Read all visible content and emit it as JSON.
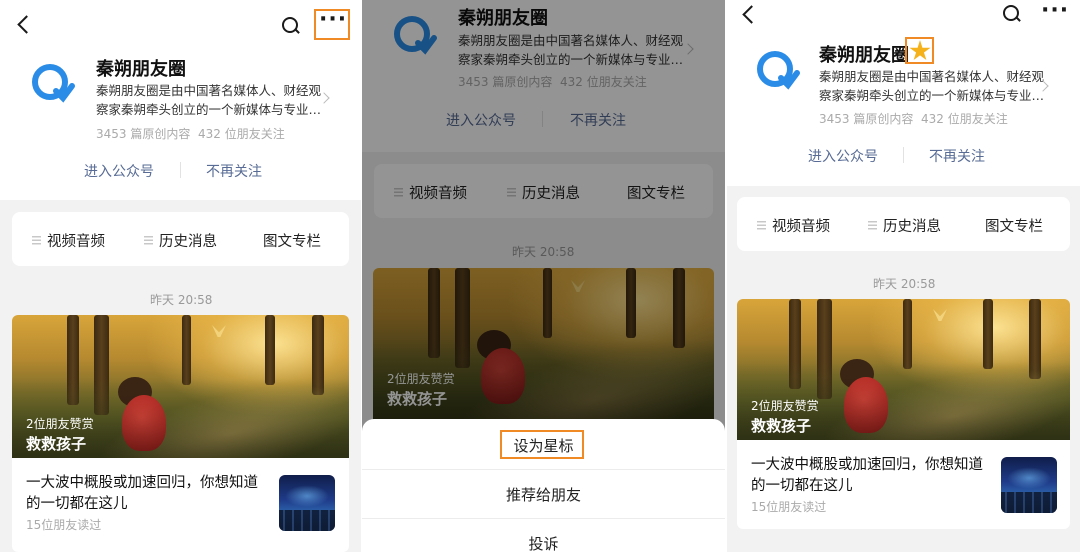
{
  "account": {
    "name": "秦朔朋友圈",
    "description_line1": "秦朔朋友圈是由中国著名媒体人、财经观",
    "description_line2": "察家秦朔牵头创立的一个新媒体与专业…",
    "articles_count": "3453 篇原创内容",
    "friends_following": "432 位朋友关注"
  },
  "actions": {
    "enter": "进入公众号",
    "unfollow": "不再关注"
  },
  "menu": [
    "视频音频",
    "历史消息",
    "图文专栏"
  ],
  "feed": {
    "date": "昨天 20:58",
    "cover_sub": "2位朋友赞赏",
    "cover_title": "救救孩子",
    "article_line1": "一大波中概股或加速回归，你想知道",
    "article_line2": "的一切都在这儿",
    "article_meta": "15位朋友读过"
  },
  "sheet": {
    "set_star": "设为星标",
    "recommend": "推荐给朋友",
    "report": "投诉"
  },
  "colors": {
    "link": "#576b95",
    "highlight": "#f08a24",
    "star": "#f5b21b",
    "logo_blue": "#2a8ce6"
  }
}
